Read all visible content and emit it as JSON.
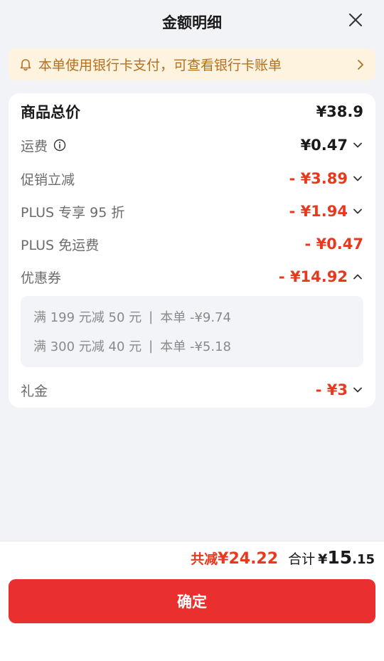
{
  "header": {
    "title": "金额明细"
  },
  "notice": {
    "text": "本单使用银行卡支付，可查看银行卡账单"
  },
  "rows": [
    {
      "label": "商品总价",
      "value": "¥38.9"
    },
    {
      "label": "运费",
      "value": "¥0.47"
    },
    {
      "label": "促销立减",
      "value": "- ¥3.89"
    },
    {
      "label": "PLUS 专享 95 折",
      "value": "- ¥1.94"
    },
    {
      "label": "PLUS 免运费",
      "value": "- ¥0.47"
    },
    {
      "label": "优惠券",
      "value": "- ¥14.92"
    },
    {
      "label": "礼金",
      "value": "- ¥3"
    }
  ],
  "coupons": [
    {
      "rule": "满 199 元减 50 元",
      "sep": "|",
      "detail": "本单 -¥9.74"
    },
    {
      "rule": "满 300 元减 40 元",
      "sep": "|",
      "detail": "本单 -¥5.18"
    }
  ],
  "footer": {
    "reduce_label": "共减",
    "reduce_value": "¥24.22",
    "total_label": "合计",
    "total_yen": "¥",
    "total_int": "15",
    "total_dec": ".15",
    "confirm_label": "确定"
  },
  "icons": {
    "close": "close-icon",
    "bell": "bell-icon",
    "chevron_right": "chevron-right-icon",
    "info": "info-icon",
    "caret_down": "chevron-down-icon",
    "caret_up": "chevron-up-icon"
  },
  "colors": {
    "accent_red": "#e8391f",
    "button_red": "#e9302e",
    "notice_bg": "#fdf3de",
    "notice_text": "#b5701d",
    "page_bg": "#f2f3f7"
  }
}
